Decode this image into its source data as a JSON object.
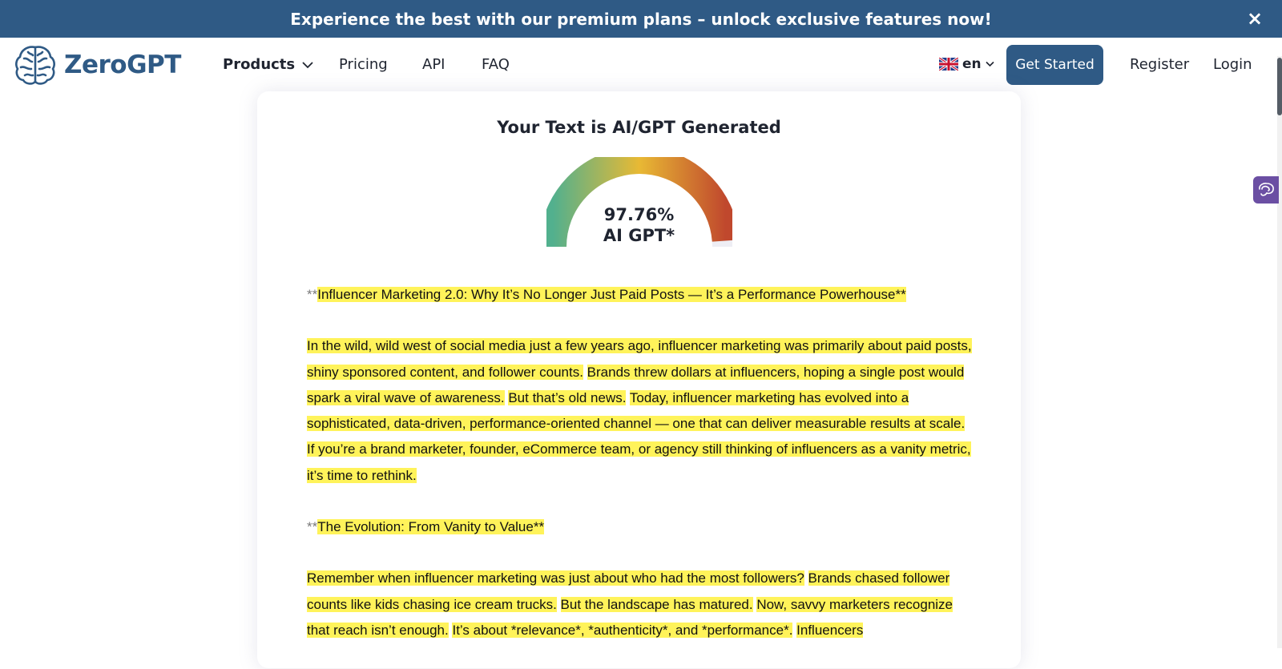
{
  "promo": {
    "text": "Experience the best with our premium plans – unlock exclusive features now!",
    "close_glyph": "×"
  },
  "brand": {
    "name": "ZeroGPT",
    "color": "#2f5a85"
  },
  "nav": {
    "products": "Products",
    "pricing": "Pricing",
    "api": "API",
    "faq": "FAQ",
    "lang": "en",
    "get_started": "Get Started",
    "register": "Register",
    "login": "Login"
  },
  "result": {
    "title": "Your Text is AI/GPT Generated",
    "percent": "97.76%",
    "label": "AI GPT*",
    "level": 0.9776
  },
  "content": {
    "heading1_marker": "**",
    "heading1": "Influencer Marketing 2.0: Why It’s No Longer Just Paid Posts — It’s a Performance Powerhouse**",
    "p1": [
      "In the wild, wild west of social media just a few years ago, influencer marketing was primarily about paid posts, shiny sponsored content, and follower counts.",
      "Brands threw dollars at influencers, hoping a single post would spark a viral wave of awareness.",
      "But that’s old news.",
      "Today, influencer marketing has evolved into a sophisticated, data-driven, performance-oriented channel — one that can deliver measurable results at scale.",
      "If you’re a brand marketer, founder, eCommerce team, or agency still thinking of influencers as a vanity metric, it’s time to rethink."
    ],
    "heading2_marker": "**",
    "heading2": "The Evolution: From Vanity to Value**",
    "p2": [
      "Remember when influencer marketing was just about who had the most followers?",
      "Brands chased follower counts like kids chasing ice cream trucks.",
      "But the landscape has matured.",
      "Now, savvy marketers recognize that reach isn’t enough.",
      "It’s about *relevance*, *authenticity*, and *performance*.",
      "Influencers"
    ]
  }
}
